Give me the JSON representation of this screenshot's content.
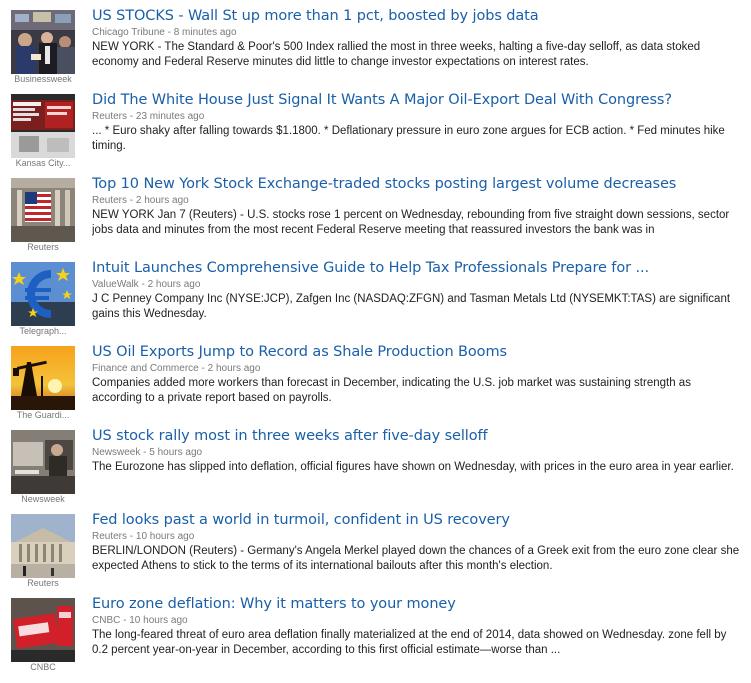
{
  "news_items": [
    {
      "headline": "US STOCKS - Wall St up more than 1 pct, boosted by jobs data",
      "source": "Chicago Tribune",
      "time": "8 minutes ago",
      "snippet": "NEW YORK - The Standard & Poor's 500 Index rallied the most in three weeks, halting a five-day selloff, as data stoked economy and Federal Reserve minutes did little to change investor expectations on interest rates.",
      "thumb_source": "Businessweek",
      "thumb_icon": "trading-floor-photo"
    },
    {
      "headline": "Did The White House Just Signal It Wants A Major Oil-Export Deal With Congress?",
      "source": "Reuters",
      "time": "23 minutes ago",
      "snippet": "... * Euro shaky after falling towards $1.1800. * Deflationary pressure in euro zone argues for ECB action. * Fed minutes hike timing.",
      "thumb_source": "Kansas City...",
      "thumb_icon": "stock-board-photo"
    },
    {
      "headline": "Top 10 New York Stock Exchange-traded stocks posting largest volume decreases",
      "source": "Reuters",
      "time": "2 hours ago",
      "snippet": "NEW YORK Jan 7 (Reuters) - U.S. stocks rose 1 percent on Wednesday, rebounding from five straight down sessions, sector jobs data and minutes from the most recent Federal Reserve meeting that reassured investors the bank was in",
      "thumb_source": "Reuters",
      "thumb_icon": "nyse-facade-photo"
    },
    {
      "headline": "Intuit Launches Comprehensive Guide to Help Tax Professionals Prepare for ...",
      "source": "ValueWalk",
      "time": "2 hours ago",
      "snippet": "J C Penney Company Inc (NYSE:JCP), Zafgen Inc (NASDAQ:ZFGN) and Tasman Metals Ltd (NYSEMKT:TAS) are significant gains this Wednesday.",
      "thumb_source": "Telegraph...",
      "thumb_icon": "euro-sculpture-photo"
    },
    {
      "headline": "US Oil Exports Jump to Record as Shale Production Booms",
      "source": "Finance and Commerce",
      "time": "2 hours ago",
      "snippet": "Companies added more workers than forecast in December, indicating the U.S. job market was sustaining strength as according to a private report based on payrolls.",
      "thumb_source": "The Guardi...",
      "thumb_icon": "oil-pump-sunset-photo"
    },
    {
      "headline": "US stock rally most in three weeks after five-day selloff",
      "source": "Newsweek",
      "time": "5 hours ago",
      "snippet": "The Eurozone has slipped into deflation, official figures have shown on Wednesday, with prices in the euro area in year earlier.",
      "thumb_source": "Newsweek",
      "thumb_icon": "sales-window-photo"
    },
    {
      "headline": "Fed looks past a world in turmoil, confident in US recovery",
      "source": "Reuters",
      "time": "10 hours ago",
      "snippet": "BERLIN/LONDON (Reuters) - Germany's Angela Merkel played down the chances of a Greek exit from the euro zone clear she expected Athens to stick to the terms of its international bailouts after this month's election.",
      "thumb_source": "Reuters",
      "thumb_icon": "parliament-building-photo"
    },
    {
      "headline": "Euro zone deflation: Why it matters to your money",
      "source": "CNBC",
      "time": "10 hours ago",
      "snippet": "The long-feared threat of euro area deflation finally materialized at the end of 2014, data showed on Wednesday. zone fell by 0.2 percent year-on-year in December, according to this first official estimate—worse than ...",
      "thumb_source": "CNBC",
      "thumb_icon": "sale-sign-photo"
    }
  ],
  "meta_separator": " - ",
  "colors": {
    "headline": "#1a5fa8",
    "meta": "#7a7a7a",
    "snippet": "#222222",
    "thumb_source": "#777777"
  }
}
